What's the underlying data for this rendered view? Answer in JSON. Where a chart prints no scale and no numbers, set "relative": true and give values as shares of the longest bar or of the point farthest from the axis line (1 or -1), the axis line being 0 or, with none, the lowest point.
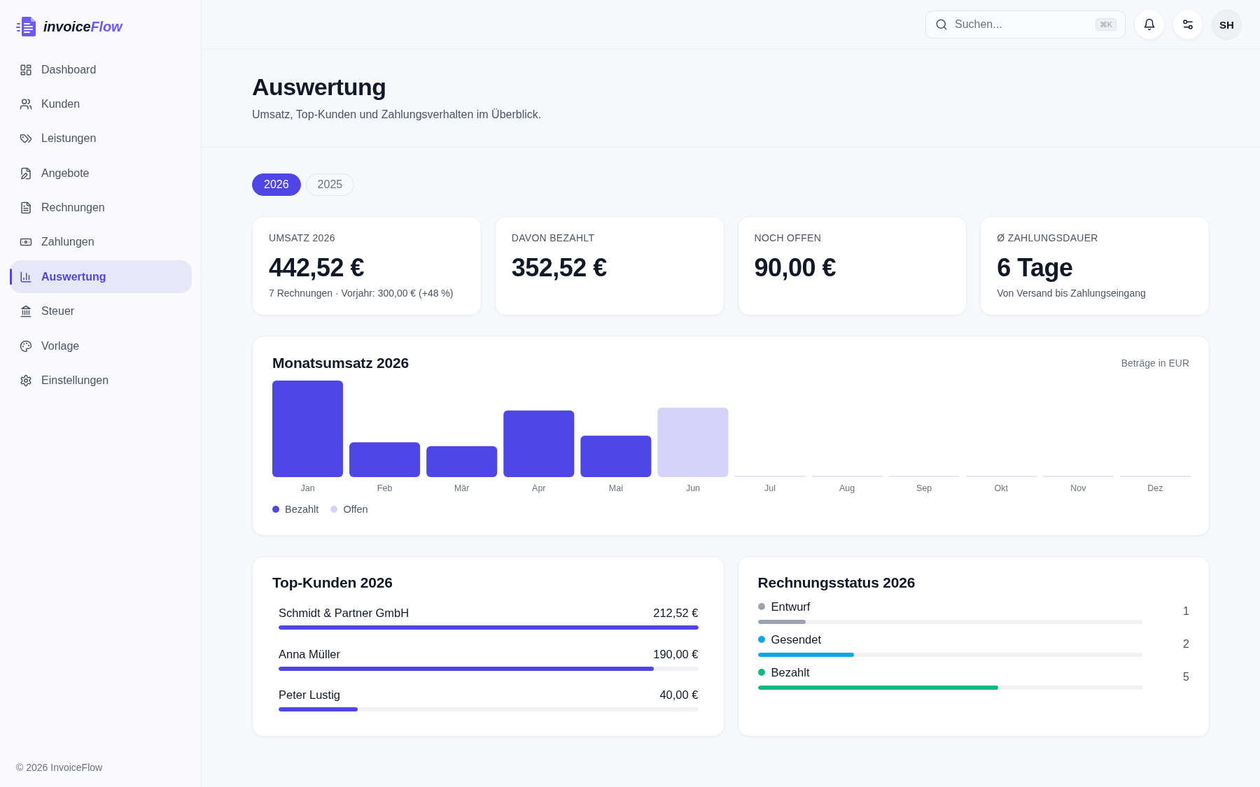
{
  "brand": {
    "name": "invoice",
    "name_accent": "Flow"
  },
  "sidebar": {
    "items": [
      {
        "label": "Dashboard",
        "selected": false
      },
      {
        "label": "Kunden",
        "selected": false
      },
      {
        "label": "Leistungen",
        "selected": false
      },
      {
        "label": "Angebote",
        "selected": false
      },
      {
        "label": "Rechnungen",
        "selected": false
      },
      {
        "label": "Zahlungen",
        "selected": false
      },
      {
        "label": "Auswertung",
        "selected": true
      },
      {
        "label": "Steuer",
        "selected": false
      },
      {
        "label": "Vorlage",
        "selected": false
      },
      {
        "label": "Einstellungen",
        "selected": false
      }
    ],
    "footer": "© 2026 InvoiceFlow"
  },
  "topbar": {
    "search": {
      "placeholder": "Suchen...",
      "shortcut": "⌘K"
    },
    "avatar": {
      "initials": "SH"
    }
  },
  "header": {
    "title": "Auswertung",
    "subtitle": "Umsatz, Top-Kunden und Zahlungsverhalten im Überblick."
  },
  "year_tabs": [
    {
      "label": "2026",
      "selected": true
    },
    {
      "label": "2025",
      "selected": false
    }
  ],
  "kpis": [
    {
      "label": "UMSATZ 2026",
      "value": "442,52 €",
      "note": "7 Rechnungen · Vorjahr: 300,00 € (+48 %)"
    },
    {
      "label": "DAVON BEZAHLT",
      "value": "352,52 €"
    },
    {
      "label": "NOCH OFFEN",
      "value": "90,00 €"
    },
    {
      "label": "Ø ZAHLUNGSDAUER",
      "value": "6 Tage",
      "note": "Von Versand bis Zahlungseingang"
    }
  ],
  "monthly_revenue": {
    "note": "Beträge in EUR",
    "chart_data": {
      "type": "bar",
      "title": "Monatsumsatz 2026",
      "categories": [
        "Jan",
        "Feb",
        "Mär",
        "Apr",
        "Mai",
        "Jun",
        "Jul",
        "Aug",
        "Sep",
        "Okt",
        "Nov",
        "Dez"
      ],
      "stacked": true,
      "relative": true,
      "series": [
        {
          "name": "Bezahlt",
          "color": "#4f46e5",
          "values": [
            1,
            0.36,
            0.32,
            0.69,
            0.43,
            0,
            0,
            0,
            0,
            0,
            0,
            0
          ]
        },
        {
          "name": "Offen",
          "color": "#d4d1fa",
          "values": [
            0,
            0,
            0,
            0,
            0,
            0.72,
            0,
            0,
            0,
            0,
            0,
            0
          ]
        }
      ]
    }
  },
  "top_customers": {
    "title": "Top-Kunden 2026",
    "items": [
      {
        "name": "Schmidt & Partner GmbH",
        "amount": "212,52 €",
        "level": 1.0
      },
      {
        "name": "Anna Müller",
        "amount": "190,00 €",
        "level": 0.894
      },
      {
        "name": "Peter Lustig",
        "amount": "40,00 €",
        "level": 0.188
      }
    ]
  },
  "invoice_status": {
    "title": "Rechnungsstatus 2026",
    "items": [
      {
        "label": "Entwurf",
        "count": "1",
        "color": "#9ca3af",
        "level": 0.125
      },
      {
        "label": "Gesendet",
        "count": "2",
        "color": "#0ea5e9",
        "level": 0.25
      },
      {
        "label": "Bezahlt",
        "count": "5",
        "color": "#10b981",
        "level": 0.625
      }
    ]
  }
}
